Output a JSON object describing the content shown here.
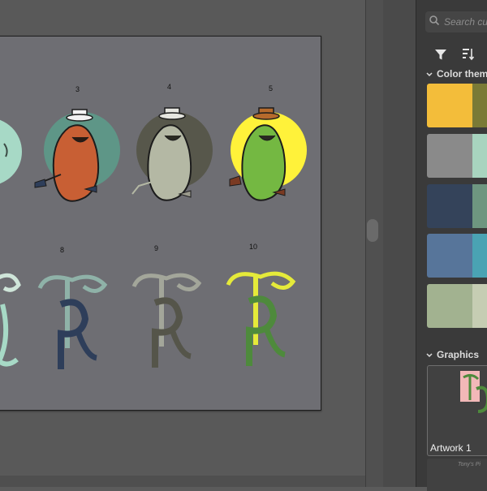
{
  "canvas": {
    "item_numbers": [
      "3",
      "4",
      "5",
      "8",
      "9",
      "10"
    ]
  },
  "panel": {
    "search_placeholder": "Search cu",
    "sections": {
      "color_themes": "Color theme",
      "graphics": "Graphics"
    },
    "color_themes": [
      [
        "#f3bd3a",
        "#7a7a36"
      ],
      [
        "#8a8a8a",
        "#a8d4bf"
      ],
      [
        "#34435a",
        "#6e9680"
      ],
      [
        "#57759a",
        "#4aa3b3"
      ],
      [
        "#a2b290",
        "#c6cdb3"
      ]
    ],
    "graphics": [
      {
        "label": "Artwork 1"
      },
      {
        "label": "Tony's Pi"
      }
    ]
  },
  "icons": [
    "search-icon",
    "filter-icon",
    "sort-icon",
    "chevron-down-icon"
  ]
}
